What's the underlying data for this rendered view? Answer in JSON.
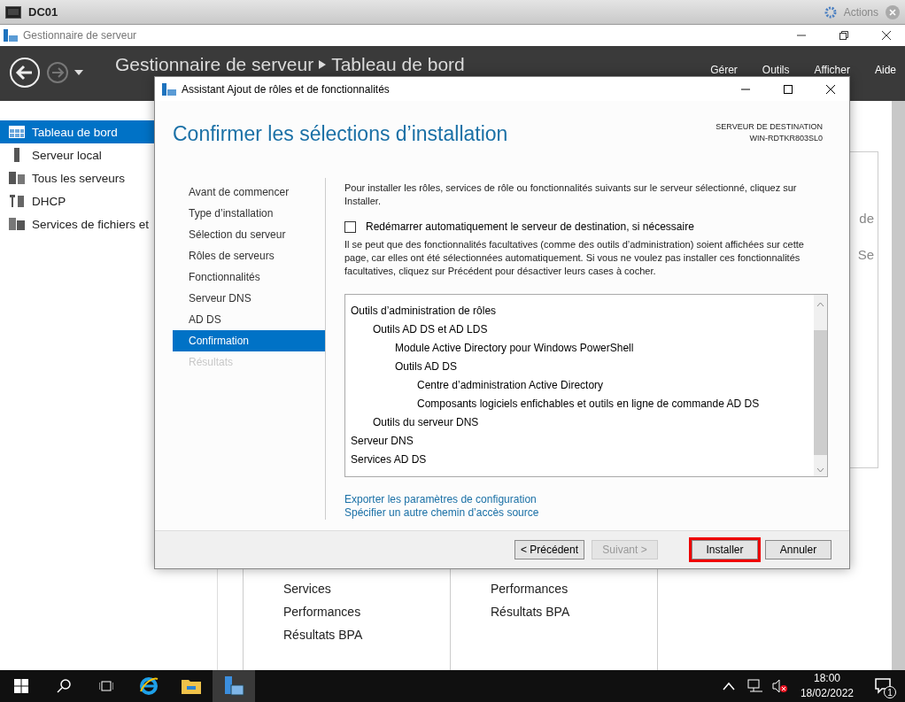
{
  "vm_bar": {
    "title": "DC01",
    "actions": "Actions"
  },
  "window": {
    "title": "Gestionnaire de serveur"
  },
  "header": {
    "breadcrumb": [
      "Gestionnaire de serveur",
      "Tableau de bord"
    ],
    "menu": [
      "Gérer",
      "Outils",
      "Afficher",
      "Aide"
    ]
  },
  "sidebar": {
    "items": [
      {
        "label": "Tableau de bord",
        "kind": "dashboard",
        "selected": true
      },
      {
        "label": "Serveur local",
        "kind": "server",
        "selected": false
      },
      {
        "label": "Tous les serveurs",
        "kind": "servers",
        "selected": false
      },
      {
        "label": "DHCP",
        "kind": "tools",
        "selected": false
      },
      {
        "label": "Services de fichiers et",
        "kind": "files",
        "selected": false
      }
    ]
  },
  "background": {
    "fragments": [
      "de",
      "Se"
    ],
    "tiles": [
      {
        "items": [
          "Services",
          "Performances",
          "Résultats BPA"
        ]
      },
      {
        "items": [
          "Performances",
          "Résultats BPA"
        ]
      }
    ]
  },
  "dialog": {
    "title": "Assistant Ajout de rôles et de fonctionnalités",
    "heading": "Confirmer les sélections d’installation",
    "destination_label": "SERVEUR DE DESTINATION",
    "destination_server": "WIN-RDTKR803SL0",
    "steps": [
      {
        "label": "Avant de commencer",
        "selected": false,
        "disabled": false
      },
      {
        "label": "Type d’installation",
        "selected": false,
        "disabled": false
      },
      {
        "label": "Sélection du serveur",
        "selected": false,
        "disabled": false
      },
      {
        "label": "Rôles de serveurs",
        "selected": false,
        "disabled": false
      },
      {
        "label": "Fonctionnalités",
        "selected": false,
        "disabled": false
      },
      {
        "label": "Serveur DNS",
        "selected": false,
        "disabled": false
      },
      {
        "label": "AD DS",
        "selected": false,
        "disabled": false
      },
      {
        "label": "Confirmation",
        "selected": true,
        "disabled": false
      },
      {
        "label": "Résultats",
        "selected": false,
        "disabled": true
      }
    ],
    "intro": "Pour installer les rôles, services de rôle ou fonctionnalités suivants sur le serveur sélectionné, cliquez sur Installer.",
    "restart": {
      "label": "Redémarrer automatiquement le serveur de destination, si nécessaire",
      "checked": false
    },
    "note": "Il se peut que des fonctionnalités facultatives (comme des outils d’administration) soient affichées sur cette page, car elles ont été sélectionnées automatiquement. Si vous ne voulez pas installer ces fonctionnalités facultatives, cliquez sur Précédent pour désactiver leurs cases à cocher.",
    "tree": [
      {
        "label": "Outils d’administration de rôles",
        "children": [
          {
            "label": "Outils AD DS et AD LDS",
            "children": [
              {
                "label": "Module Active Directory pour Windows PowerShell"
              },
              {
                "label": "Outils AD DS",
                "children": [
                  {
                    "label": "Centre d’administration Active Directory"
                  },
                  {
                    "label": "Composants logiciels enfichables et outils en ligne de commande AD DS"
                  }
                ]
              }
            ]
          },
          {
            "label": "Outils du serveur DNS"
          }
        ]
      },
      {
        "label": "Serveur DNS"
      },
      {
        "label": "Services AD DS"
      }
    ],
    "links": [
      "Exporter les paramètres de configuration",
      "Spécifier un autre chemin d’accès source"
    ],
    "buttons": [
      {
        "label": "< Précédent",
        "disabled": false,
        "highlighted": false
      },
      {
        "label": "Suivant >",
        "disabled": true,
        "highlighted": false
      },
      {
        "label": "Installer",
        "disabled": false,
        "highlighted": true
      },
      {
        "label": "Annuler",
        "disabled": false,
        "highlighted": false
      }
    ]
  },
  "taskbar": {
    "time": "18:00",
    "date": "18/02/2022",
    "notifications": "1"
  }
}
